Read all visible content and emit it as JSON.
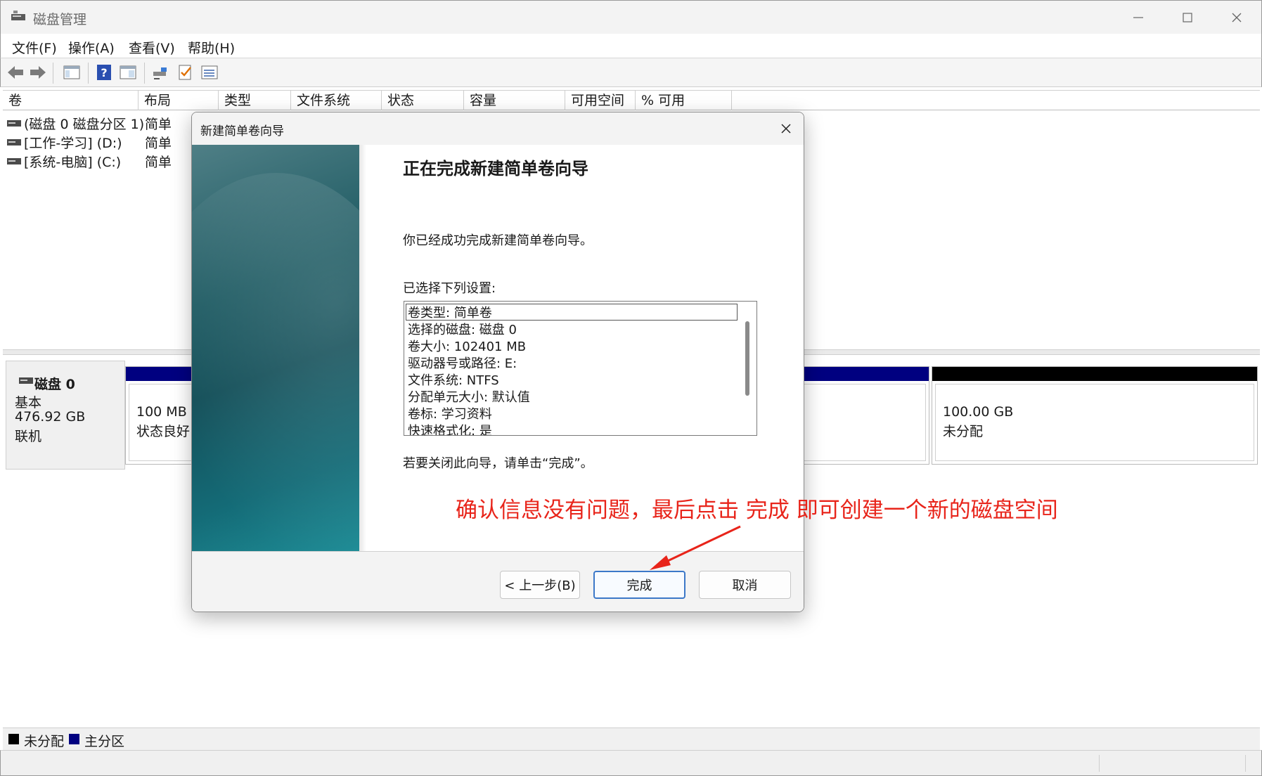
{
  "window": {
    "title": "磁盘管理",
    "controls": {
      "minimize": "minimize-icon",
      "maximize": "maximize-icon",
      "close": "close-icon"
    }
  },
  "menu": [
    "文件(F)",
    "操作(A)",
    "查看(V)",
    "帮助(H)"
  ],
  "toolbar": [
    "back-icon",
    "forward-icon",
    "console-tree-icon",
    "help-icon",
    "properties-icon",
    "connect-icon",
    "checklist-icon",
    "list-icon"
  ],
  "columns": [
    "卷",
    "布局",
    "类型",
    "文件系统",
    "状态",
    "容量",
    "可用空间",
    "% 可用"
  ],
  "volumes": [
    {
      "name": "(磁盘 0 磁盘分区 1)",
      "layout": "简单"
    },
    {
      "name": "[工作-学习] (D:)",
      "layout": "简单"
    },
    {
      "name": "[系统-电脑] (C:)",
      "layout": "简单"
    }
  ],
  "disk": {
    "name": "磁盘 0",
    "type": "基本",
    "size": "476.92 GB",
    "status": "联机",
    "partitions": [
      {
        "size": "100 MB",
        "status": "状态良好 (",
        "band_color": "#000080"
      },
      {
        "size": "100.00 GB",
        "status": "未分配",
        "band_color": "#000000"
      }
    ]
  },
  "legend": [
    {
      "label": "未分配",
      "color": "#000000"
    },
    {
      "label": "主分区",
      "color": "#000080"
    }
  ],
  "dialog": {
    "title": "新建简单卷向导",
    "heading": "正在完成新建简单卷向导",
    "intro": "你已经成功完成新建简单卷向导。",
    "settings_label": "已选择下列设置:",
    "settings": [
      "卷类型: 简单卷",
      "选择的磁盘: 磁盘 0",
      "卷大小: 102401 MB",
      "驱动器号或路径: E:",
      "文件系统: NTFS",
      "分配单元大小: 默认值",
      "卷标: 学习资料",
      "快速格式化: 是"
    ],
    "close_hint": "若要关闭此向导，请单击“完成”。",
    "buttons": {
      "back": "< 上一步(B)",
      "finish": "完成",
      "cancel": "取消"
    }
  },
  "annotation": {
    "text": "确认信息没有问题，最后点击 完成 即可创建一个新的磁盘空间",
    "color": "#e8241a"
  }
}
